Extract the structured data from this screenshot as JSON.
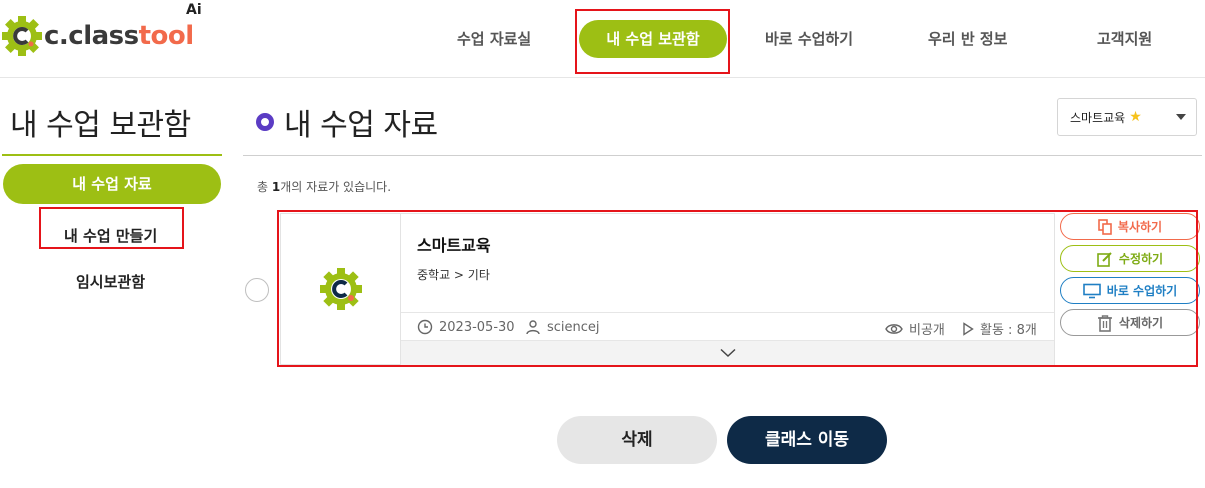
{
  "header": {
    "logo_text_1": "c.",
    "logo_text_2": "class",
    "logo_text_3": "tool",
    "logo_ai": "Ai",
    "nav": [
      {
        "label": "수업 자료실"
      },
      {
        "label": "내 수업 보관함",
        "active": true
      },
      {
        "label": "바로 수업하기"
      },
      {
        "label": "우리 반 정보"
      },
      {
        "label": "고객지원"
      }
    ]
  },
  "sidebar": {
    "title": "내 수업 보관함",
    "items": [
      {
        "label": "내 수업 자료",
        "active": true
      },
      {
        "label": "내 수업 만들기"
      },
      {
        "label": "임시보관함"
      }
    ]
  },
  "main": {
    "title": "내 수업 자료",
    "filter": {
      "selected": "스마트교육",
      "star": "★"
    },
    "count_prefix": "총 ",
    "count_value": "1",
    "count_suffix": "개의 자료가 있습니다.",
    "card": {
      "title": "스마트교육",
      "subtitle": "중학교 > 기타",
      "date": "2023-05-30",
      "author": "sciencej",
      "visibility": "비공개",
      "activities": "활동 : 8개",
      "actions": {
        "copy": "복사하기",
        "edit": "수정하기",
        "live": "바로 수업하기",
        "delete": "삭제하기"
      }
    }
  },
  "footer": {
    "delete_label": "삭제",
    "move_label": "클래스 이동"
  },
  "colors": {
    "brand_green": "#9dbf14",
    "accent_orange": "#f26a4b",
    "navy": "#0e2a47",
    "title_dot": "#5b3cc4",
    "annotation_red": "#e5141a"
  }
}
